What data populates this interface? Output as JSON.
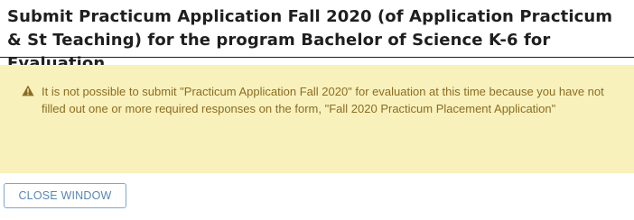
{
  "header": {
    "title": "Submit Practicum Application Fall 2020 (of Application Practicum & St Teaching) for the program Bachelor of Science K-6 for Evaluation"
  },
  "alert": {
    "icon": "warning-icon",
    "message": "It is not possible to submit \"Practicum Application Fall 2020\" for evaluation at this time because you have not filled out one or more required responses on the form, \"Fall 2020 Practicum Placement Application\"",
    "background_color": "#f9f1bc",
    "text_color": "#8a6d22"
  },
  "actions": {
    "close_label": "CLOSE WINDOW"
  }
}
